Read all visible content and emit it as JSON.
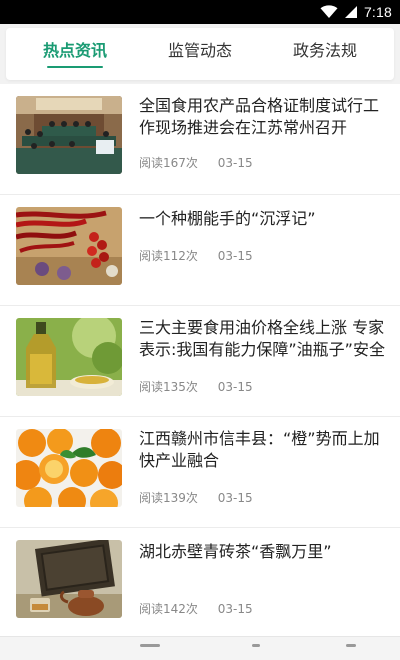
{
  "status": {
    "time": "7:18",
    "icons": [
      "wifi-icon",
      "signal-icon"
    ]
  },
  "tabs": [
    {
      "label": "热点资讯",
      "active": true
    },
    {
      "label": "监管动态",
      "active": false
    },
    {
      "label": "政务法规",
      "active": false
    }
  ],
  "colors": {
    "accent": "#1a9b73",
    "text": "#222222",
    "meta": "#888888"
  },
  "articles": [
    {
      "title": "全国食用农产品合格证制度试行工作现场推进会在江苏常州召开",
      "reads": "阅读167次",
      "date": "03-15",
      "image": "conference-room-photo"
    },
    {
      "title": "一个种棚能手的“沉浮记”",
      "reads": "阅读112次",
      "date": "03-15",
      "image": "chili-peppers-photo"
    },
    {
      "title": "三大主要食用油价格全线上涨 专家表示:我国有能力保障”油瓶子”安全",
      "reads": "阅读135次",
      "date": "03-15",
      "image": "oil-bottle-photo"
    },
    {
      "title": "江西赣州市信丰县：“橙”势而上加快产业融合",
      "reads": "阅读139次",
      "date": "03-15",
      "image": "oranges-photo"
    },
    {
      "title": "湖北赤壁青砖茶“香飘万里”",
      "reads": "阅读142次",
      "date": "03-15",
      "image": "brick-tea-photo"
    }
  ]
}
